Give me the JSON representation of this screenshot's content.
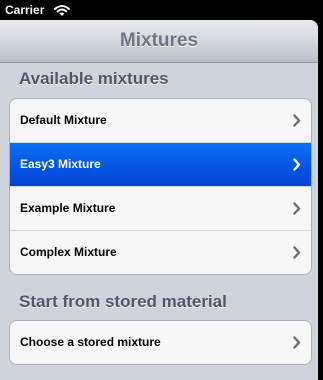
{
  "status_bar": {
    "carrier": "Carrier"
  },
  "nav": {
    "title": "Mixtures"
  },
  "sections": {
    "available": {
      "header": "Available mixtures",
      "items": [
        {
          "label": "Default Mixture",
          "selected": false
        },
        {
          "label": "Easy3 Mixture",
          "selected": true
        },
        {
          "label": "Example Mixture",
          "selected": false
        },
        {
          "label": "Complex Mixture",
          "selected": false
        }
      ]
    },
    "stored": {
      "header": "Start from stored material",
      "items": [
        {
          "label": "Choose a stored mixture",
          "selected": false
        }
      ]
    }
  },
  "colors": {
    "selected_row": "#0553e1",
    "background": "#cfd3dc",
    "header_text": "#4c566c",
    "chevron": "#6e6e6e",
    "chevron_selected": "#ffffff"
  },
  "icons": {
    "status": "wifi-icon",
    "disclosure": "chevron-right-icon"
  }
}
